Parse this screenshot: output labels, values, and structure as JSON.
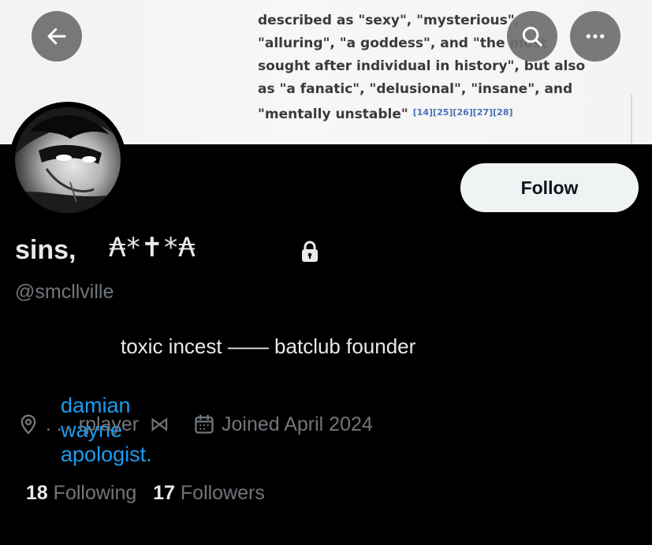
{
  "banner": {
    "lines": [
      "described as \"sexy\", \"mysterious\",",
      "\"alluring\", \"a goddess\", and \"the most",
      "sought after individual in history\", but also",
      "as  \"a fanatic\", \"delusional\", \"insane\", and",
      "\"mentally unstable\""
    ],
    "citations": "[14][25][26][27][28]"
  },
  "header": {
    "back_icon": "arrow-left-icon",
    "search_icon": "search-icon",
    "more_icon": "more-horizontal-icon"
  },
  "profile": {
    "display_name": "sins,",
    "name_decoration": "₳*✝*₳",
    "protected_icon": "lock-icon",
    "handle": "@smcllville",
    "follow_label": "Follow",
    "bio_line1": "toxic incest —— batclub founder",
    "bio_line2": [
      "damian",
      "wayne",
      "apologist."
    ],
    "location_icon": "location-pin-icon",
    "location": ". . . rplayer  ⋈",
    "calendar_icon": "calendar-icon",
    "joined": "Joined April 2024",
    "following_count": "18",
    "following_label": "Following",
    "followers_count": "17",
    "followers_label": "Followers"
  },
  "colors": {
    "background": "#000000",
    "text_primary": "#e7e9ea",
    "text_secondary": "#71767b",
    "link": "#1d9bf0",
    "follow_button_bg": "#eff3f4"
  }
}
